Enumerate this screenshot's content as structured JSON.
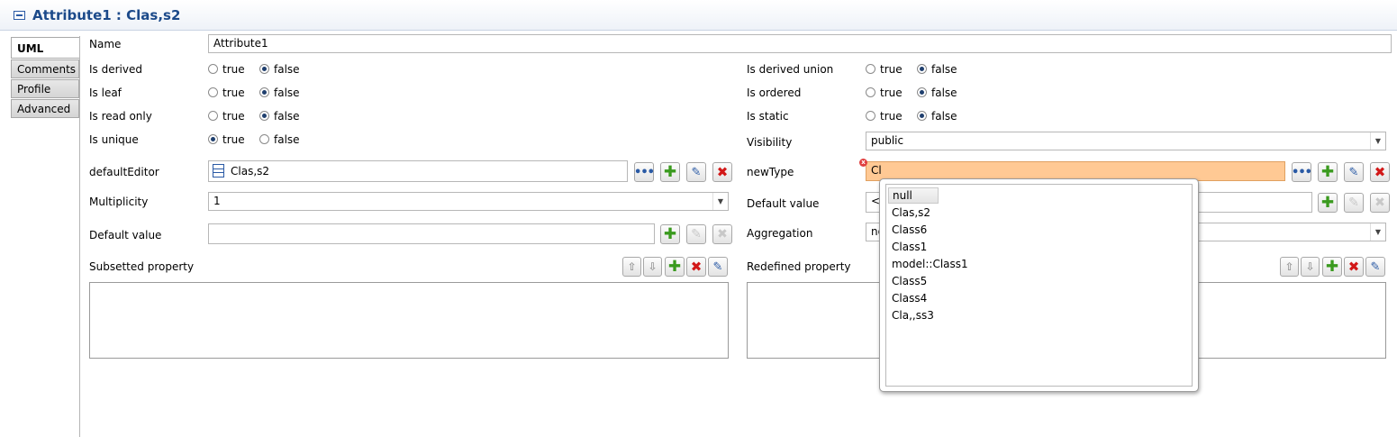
{
  "window": {
    "title": "Attribute1 : Clas,s2"
  },
  "tabs": [
    "UML",
    "Comments",
    "Profile",
    "Advanced"
  ],
  "left": {
    "name_label": "Name",
    "name_value": "Attribute1",
    "is_derived": "Is derived",
    "is_leaf": "Is leaf",
    "is_read_only": "Is read only",
    "is_unique": "Is unique",
    "default_editor_label": "defaultEditor",
    "default_editor_value": "Clas,s2",
    "multiplicity_label": "Multiplicity",
    "multiplicity_value": "1",
    "default_value_label": "Default value",
    "default_value_value": "",
    "subsetted_label": "Subsetted property"
  },
  "right": {
    "is_derived_union": "Is derived union",
    "is_ordered": "Is ordered",
    "is_static": "Is static",
    "visibility_label": "Visibility",
    "visibility_value": "public",
    "new_type_label": "newType",
    "new_type_value": "Cl",
    "default_value_label": "Default value",
    "default_value_value": "<U",
    "aggregation_label": "Aggregation",
    "aggregation_value": "no",
    "redefined_label": "Redefined property"
  },
  "radio": {
    "true": "true",
    "false": "false"
  },
  "popup_items": [
    "null",
    "Clas,s2",
    "Class6",
    "Class1",
    "model::Class1",
    "Class5",
    "Class4",
    "Cla,,ss3"
  ],
  "colors": {
    "title": "#1c4a8a",
    "error_field": "#ffc994",
    "plus": "#3a9a1e",
    "delete": "#d21818"
  }
}
